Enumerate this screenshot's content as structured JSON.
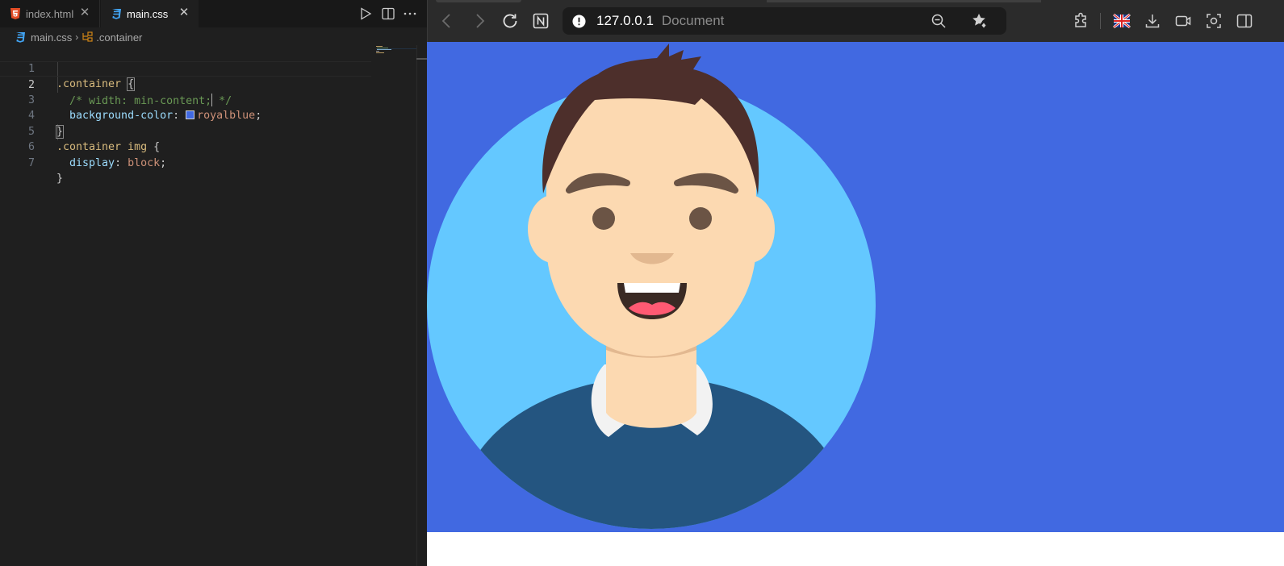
{
  "editor": {
    "tabs": [
      {
        "label": "index.html",
        "icon": "html5-icon"
      },
      {
        "label": "main.css",
        "icon": "css3-icon",
        "active": true
      }
    ],
    "breadcrumb": {
      "file": "main.css",
      "symbol": ".container"
    },
    "lines": {
      "l1": {
        "num": "1",
        "selector": ".container",
        "brace": "{"
      },
      "l2": {
        "num": "2",
        "comment_a": "/* width: min-content;",
        "comment_b": " */"
      },
      "l3": {
        "num": "3",
        "prop": "background-color",
        "colon": ":",
        "value": "royalblue",
        "semi": ";"
      },
      "l4": {
        "num": "4",
        "brace": "}"
      },
      "l5": {
        "num": "5",
        "selector": ".container img",
        "brace": " {"
      },
      "l6": {
        "num": "6",
        "prop": "display",
        "colon": ":",
        "value": "block",
        "semi": ";"
      },
      "l7": {
        "num": "7",
        "brace": "}"
      }
    },
    "swatch_color": "#4169e1"
  },
  "browser": {
    "host": "127.0.0.1",
    "page_title": "Document",
    "page_background": "#4169e1"
  },
  "colors": {
    "editor_bg": "#1f1f1f",
    "selector": "#d7ba7d",
    "property": "#9cdcfe",
    "value": "#ce9178",
    "comment": "#6a9955",
    "royalblue": "#4169e1"
  }
}
